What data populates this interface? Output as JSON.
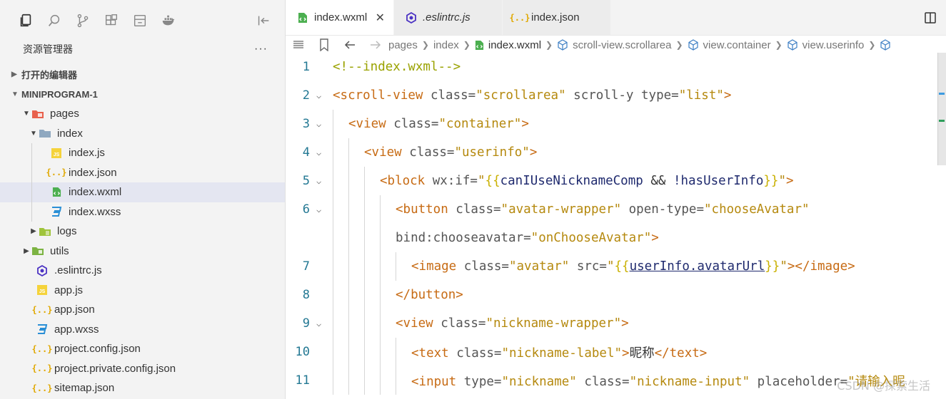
{
  "activity_bar": {
    "icons": [
      "files-icon",
      "search-icon",
      "source-control-icon",
      "extensions-icon",
      "pages-icon",
      "docker-icon"
    ],
    "collapse_icon": "collapse-sidebar-icon"
  },
  "explorer": {
    "title": "资源管理器",
    "more": "···",
    "open_editors": "打开的编辑器",
    "project": "MINIPROGRAM-1",
    "tree": [
      {
        "label": "pages",
        "type": "folder-pages",
        "depth": 0,
        "arrow": "open"
      },
      {
        "label": "index",
        "type": "folder",
        "depth": 1,
        "arrow": "open"
      },
      {
        "label": "index.js",
        "type": "js",
        "depth": 2
      },
      {
        "label": "index.json",
        "type": "json",
        "depth": 2
      },
      {
        "label": "index.wxml",
        "type": "wxml",
        "depth": 2,
        "selected": true
      },
      {
        "label": "index.wxss",
        "type": "wxss",
        "depth": 2
      },
      {
        "label": "logs",
        "type": "folder-logs",
        "depth": 1,
        "arrow": "closed"
      },
      {
        "label": "utils",
        "type": "folder-utils",
        "depth": 0,
        "arrow": "closed"
      },
      {
        "label": ".eslintrc.js",
        "type": "eslint",
        "depth": 0
      },
      {
        "label": "app.js",
        "type": "js",
        "depth": 0
      },
      {
        "label": "app.json",
        "type": "json",
        "depth": 0
      },
      {
        "label": "app.wxss",
        "type": "wxss",
        "depth": 0
      },
      {
        "label": "project.config.json",
        "type": "json",
        "depth": 0
      },
      {
        "label": "project.private.config.json",
        "type": "json",
        "depth": 0
      },
      {
        "label": "sitemap.json",
        "type": "json",
        "depth": 0
      }
    ]
  },
  "tabs": [
    {
      "label": "index.wxml",
      "type": "wxml",
      "active": true,
      "close": "✕"
    },
    {
      "label": ".eslintrc.js",
      "type": "eslint",
      "italic": true
    },
    {
      "label": "index.json",
      "type": "json"
    }
  ],
  "breadcrumb": [
    "pages",
    "index",
    "index.wxml",
    "scroll-view.scrollarea",
    "view.container",
    "view.userinfo"
  ],
  "code_lines": [
    {
      "n": "1",
      "fold": false,
      "indent": 0,
      "tokens": [
        [
          "com",
          "<!--index.wxml-->"
        ]
      ]
    },
    {
      "n": "2",
      "fold": true,
      "indent": 0,
      "tokens": [
        [
          "tag",
          "<scroll-view"
        ],
        [
          "attr",
          " class="
        ],
        [
          "str",
          "\"scrollarea\""
        ],
        [
          "attr",
          " scroll-y type="
        ],
        [
          "str",
          "\"list\""
        ],
        [
          "tag",
          ">"
        ]
      ]
    },
    {
      "n": "3",
      "fold": true,
      "indent": 1,
      "tokens": [
        [
          "tag",
          "<view"
        ],
        [
          "attr",
          " class="
        ],
        [
          "str",
          "\"container\""
        ],
        [
          "tag",
          ">"
        ]
      ]
    },
    {
      "n": "4",
      "fold": true,
      "indent": 2,
      "tokens": [
        [
          "tag",
          "<view"
        ],
        [
          "attr",
          " class="
        ],
        [
          "str",
          "\"userinfo\""
        ],
        [
          "tag",
          ">"
        ]
      ]
    },
    {
      "n": "5",
      "fold": true,
      "indent": 3,
      "tokens": [
        [
          "tag",
          "<block"
        ],
        [
          "attr",
          " wx:if="
        ],
        [
          "str",
          "\""
        ],
        [
          "brace",
          "{{"
        ],
        [
          "expr",
          "canIUseNicknameComp"
        ],
        [
          "op",
          " && "
        ],
        [
          "expr",
          "!hasUserInfo"
        ],
        [
          "brace",
          "}}"
        ],
        [
          "str",
          "\""
        ],
        [
          "tag",
          ">"
        ]
      ]
    },
    {
      "n": "6",
      "fold": true,
      "indent": 4,
      "tokens": [
        [
          "tag",
          "<button"
        ],
        [
          "attr",
          " class="
        ],
        [
          "str",
          "\"avatar-wrapper\""
        ],
        [
          "attr",
          " open-type="
        ],
        [
          "str",
          "\"chooseAvatar\""
        ]
      ]
    },
    {
      "n": "",
      "fold": false,
      "indent": 4,
      "tokens": [
        [
          "attr",
          "bind:chooseavatar="
        ],
        [
          "str",
          "\"onChooseAvatar\""
        ],
        [
          "tag",
          ">"
        ]
      ]
    },
    {
      "n": "7",
      "fold": false,
      "indent": 5,
      "tokens": [
        [
          "tag",
          "<image"
        ],
        [
          "attr",
          " class="
        ],
        [
          "str",
          "\"avatar\""
        ],
        [
          "attr",
          " src="
        ],
        [
          "str",
          "\""
        ],
        [
          "brace",
          "{{"
        ],
        [
          "expr",
          "userInfo.avatarUrl"
        ],
        [
          "brace",
          "}}"
        ],
        [
          "str",
          "\""
        ],
        [
          "tag",
          "></image>"
        ]
      ]
    },
    {
      "n": "8",
      "fold": false,
      "indent": 4,
      "tokens": [
        [
          "tag",
          "</button>"
        ]
      ]
    },
    {
      "n": "9",
      "fold": true,
      "indent": 4,
      "tokens": [
        [
          "tag",
          "<view"
        ],
        [
          "attr",
          " class="
        ],
        [
          "str",
          "\"nickname-wrapper\""
        ],
        [
          "tag",
          ">"
        ]
      ]
    },
    {
      "n": "10",
      "fold": false,
      "indent": 5,
      "tokens": [
        [
          "tag",
          "<text"
        ],
        [
          "attr",
          " class="
        ],
        [
          "str",
          "\"nickname-label\""
        ],
        [
          "tag",
          ">"
        ],
        [
          "cjk",
          "昵称"
        ],
        [
          "tag",
          "</text>"
        ]
      ]
    },
    {
      "n": "11",
      "fold": false,
      "indent": 5,
      "tokens": [
        [
          "tag",
          "<input"
        ],
        [
          "attr",
          " type="
        ],
        [
          "str",
          "\"nickname\""
        ],
        [
          "attr",
          " class="
        ],
        [
          "str",
          "\"nickname-input\""
        ],
        [
          "attr",
          " placeholder="
        ],
        [
          "str",
          "\""
        ],
        [
          "cjkstr",
          "请输入昵"
        ]
      ]
    }
  ],
  "watermark": "CSDN @探索生活",
  "colors": {
    "accent": "#237893",
    "tag": "#c76b14",
    "string": "#b5890e"
  }
}
